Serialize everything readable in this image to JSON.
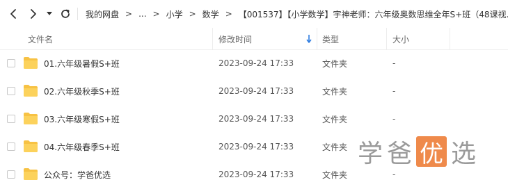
{
  "toolbar": {
    "back_icon": "chevron-left-icon",
    "forward_icon": "chevron-right-icon",
    "history_dropdown_icon": "caret-down-icon",
    "refresh_icon": "refresh-icon"
  },
  "breadcrumb": {
    "items": [
      "我的网盘",
      "...",
      "小学",
      "数学",
      "【001537】【小学数学】宇神老师：六年级奥数思维全年S+班（48课视..."
    ],
    "separator": ">"
  },
  "columns": {
    "name": "文件名",
    "modified": "修改时间",
    "type": "类型",
    "size": "大小"
  },
  "rows": [
    {
      "name": "01.六年级暑假S+班",
      "modified": "2023-09-24 17:33",
      "type": "文件夹",
      "size": "-"
    },
    {
      "name": "02.六年级秋季S+班",
      "modified": "2023-09-24 17:33",
      "type": "文件夹",
      "size": "-"
    },
    {
      "name": "03.六年级寒假S+班",
      "modified": "2023-09-24 17:33",
      "type": "文件夹",
      "size": "-"
    },
    {
      "name": "04.六年级春季S+班",
      "modified": "2023-09-24 17:33",
      "type": "文件夹",
      "size": "-"
    },
    {
      "name": "公众号：学爸优选",
      "modified": "2023-09-24 17:33",
      "type": "文件夹",
      "size": "-"
    }
  ],
  "watermark": {
    "chars": [
      "学",
      "爸",
      "优",
      "选"
    ]
  },
  "colors": {
    "folder": "#f7c244",
    "sort_arrow": "#2f7de1",
    "watermark_box": "#ef8a4b"
  }
}
